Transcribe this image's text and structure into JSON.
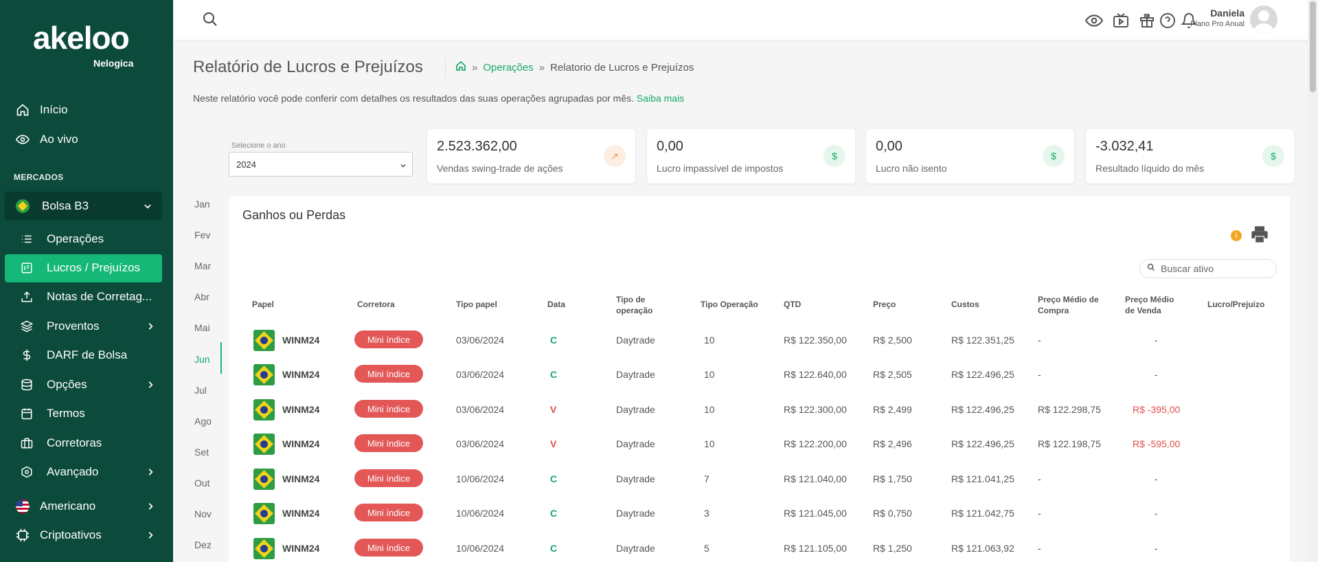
{
  "brand": {
    "name": "akeloo",
    "sub": "Nelogica"
  },
  "sidebar": {
    "top_items": [
      {
        "label": "Início",
        "icon": "home-icon"
      },
      {
        "label": "Ao vivo",
        "icon": "eye-icon"
      }
    ],
    "section": "MERCADOS",
    "market": {
      "label": "Bolsa B3",
      "icon": "brazil-flag-icon"
    },
    "sub_items": [
      {
        "label": "Operações",
        "icon": "list-icon"
      },
      {
        "label": "Lucros / Prejuízos",
        "icon": "report-icon",
        "active": true
      },
      {
        "label": "Notas de Corretag...",
        "icon": "upload-icon"
      },
      {
        "label": "Proventos",
        "icon": "layers-icon"
      },
      {
        "label": "DARF de Bolsa",
        "icon": "dollar-icon"
      },
      {
        "label": "Opções",
        "icon": "database-icon"
      },
      {
        "label": "Termos",
        "icon": "calendar-icon"
      },
      {
        "label": "Corretoras",
        "icon": "briefcase-icon"
      },
      {
        "label": "Avançado",
        "icon": "advanced-icon"
      }
    ],
    "markets_other": [
      {
        "label": "Americano",
        "icon": "us-flag-icon"
      },
      {
        "label": "Criptoativos",
        "icon": "chip-icon"
      }
    ]
  },
  "topbar": {
    "user_name": "Daniela",
    "user_plan": "Plano Pro Anual"
  },
  "header": {
    "title": "Relatório de Lucros e Prejuízos",
    "breadcrumb_link": "Operações",
    "breadcrumb_current": "Relatorio de Lucros e Prejuízos",
    "sep": "»",
    "description": "Neste relatório você pode conferir com detalhes os resultados das suas operações agrupadas por mês.",
    "more_link": "Saiba mais"
  },
  "year": {
    "label": "Selecione o ano",
    "value": "2024"
  },
  "cards": [
    {
      "value": "2.523.362,00",
      "label": "Vendas swing-trade de ações",
      "badge": "↗",
      "badge_bg": "#fdeee3",
      "badge_fg": "#f29a4a"
    },
    {
      "value": "0,00",
      "label": "Lucro impassível de impostos",
      "badge": "$",
      "badge_bg": "#e4f7ec",
      "badge_fg": "#16a86b"
    },
    {
      "value": "0,00",
      "label": "Lucro não isento",
      "badge": "$",
      "badge_bg": "#e4f7ec",
      "badge_fg": "#16a86b"
    },
    {
      "value": "-3.032,41",
      "label": "Resultado líquido do mês",
      "badge": "$",
      "badge_bg": "#e4f7ec",
      "badge_fg": "#16a86b"
    }
  ],
  "months": [
    "Jan",
    "Fev",
    "Mar",
    "Abr",
    "Mai",
    "Jun",
    "Jul",
    "Ago",
    "Set",
    "Out",
    "Nov",
    "Dez"
  ],
  "active_month": "Jun",
  "panel": {
    "title": "Ganhos ou Perdas",
    "info": "i",
    "search_placeholder": "Buscar ativo",
    "columns": [
      "Papel",
      "Corretora",
      "Tipo papel",
      "Data",
      "Tipo de operação",
      "Tipo Operação",
      "QTD",
      "Preço",
      "Custos",
      "Preço Médio de Compra",
      "Preço Médio de Venda",
      "Lucro/Prejuizo"
    ],
    "rows": [
      {
        "papel": "WINM24",
        "corretora": "Mini índice",
        "data": "03/06/2024",
        "cv": "C",
        "tipo_op": "Daytrade",
        "qtd": "10",
        "col_qtd": "R$ 122.350,00",
        "preco": "R$ 2,500",
        "custos": "R$ 122.351,25",
        "pm_compra": "-",
        "pm_venda": "-"
      },
      {
        "papel": "WINM24",
        "corretora": "Mini índice",
        "data": "03/06/2024",
        "cv": "C",
        "tipo_op": "Daytrade",
        "qtd": "10",
        "col_qtd": "R$ 122.640,00",
        "preco": "R$ 2,505",
        "custos": "R$ 122.496,25",
        "pm_compra": "-",
        "pm_venda": "-"
      },
      {
        "papel": "WINM24",
        "corretora": "Mini índice",
        "data": "03/06/2024",
        "cv": "V",
        "tipo_op": "Daytrade",
        "qtd": "10",
        "col_qtd": "R$ 122.300,00",
        "preco": "R$ 2,499",
        "custos": "R$ 122.496,25",
        "pm_compra": "R$ 122.298,75",
        "pm_venda": "R$ -395,00"
      },
      {
        "papel": "WINM24",
        "corretora": "Mini índice",
        "data": "03/06/2024",
        "cv": "V",
        "tipo_op": "Daytrade",
        "qtd": "10",
        "col_qtd": "R$ 122.200,00",
        "preco": "R$ 2,496",
        "custos": "R$ 122.496,25",
        "pm_compra": "R$ 122.198,75",
        "pm_venda": "R$ -595,00"
      },
      {
        "papel": "WINM24",
        "corretora": "Mini índice",
        "data": "10/06/2024",
        "cv": "C",
        "tipo_op": "Daytrade",
        "qtd": "7",
        "col_qtd": "R$ 121.040,00",
        "preco": "R$ 1,750",
        "custos": "R$ 121.041,25",
        "pm_compra": "-",
        "pm_venda": "-"
      },
      {
        "papel": "WINM24",
        "corretora": "Mini índice",
        "data": "10/06/2024",
        "cv": "C",
        "tipo_op": "Daytrade",
        "qtd": "3",
        "col_qtd": "R$ 121.045,00",
        "preco": "R$ 0,750",
        "custos": "R$ 121.042,75",
        "pm_compra": "-",
        "pm_venda": "-"
      },
      {
        "papel": "WINM24",
        "corretora": "Mini índice",
        "data": "10/06/2024",
        "cv": "C",
        "tipo_op": "Daytrade",
        "qtd": "5",
        "col_qtd": "R$ 121.105,00",
        "preco": "R$ 1,250",
        "custos": "R$ 121.063,92",
        "pm_compra": "-",
        "pm_venda": "-"
      }
    ]
  }
}
